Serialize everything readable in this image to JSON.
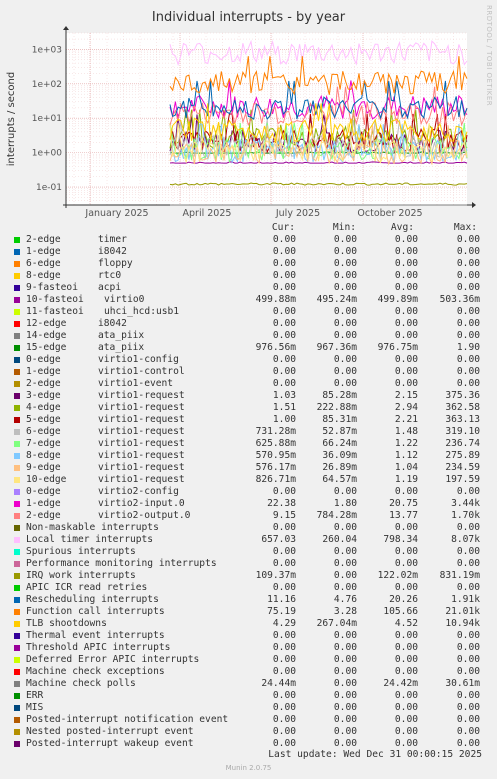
{
  "chart_data": {
    "type": "line",
    "title": "Individual interrupts - by year",
    "ylabel": "interrupts / second",
    "yscale": "log",
    "ylim": [
      0.03,
      3000
    ],
    "yticks": [
      "1e+03",
      "1e+02",
      "1e+01",
      "1e+00",
      "1e-01"
    ],
    "xticks": [
      "January 2025",
      "April 2025",
      "July 2025",
      "October 2025"
    ],
    "grid": true,
    "columns": [
      "Cur:",
      "Min:",
      "Avg:",
      "Max:"
    ],
    "series": [
      {
        "name": "2-edge",
        "device": "timer",
        "color": "#00cc00",
        "cur": "0.00",
        "min": "0.00",
        "avg": "0.00",
        "max": "0.00"
      },
      {
        "name": "1-edge",
        "device": "i8042",
        "color": "#0066b3",
        "cur": "0.00",
        "min": "0.00",
        "avg": "0.00",
        "max": "0.00"
      },
      {
        "name": "6-edge",
        "device": "floppy",
        "color": "#ff8000",
        "cur": "0.00",
        "min": "0.00",
        "avg": "0.00",
        "max": "0.00"
      },
      {
        "name": "8-edge",
        "device": "rtc0",
        "color": "#ffcc00",
        "cur": "0.00",
        "min": "0.00",
        "avg": "0.00",
        "max": "0.00"
      },
      {
        "name": "9-fasteoi",
        "device": "acpi",
        "color": "#330099",
        "cur": "0.00",
        "min": "0.00",
        "avg": "0.00",
        "max": "0.00"
      },
      {
        "name": "10-fasteoi",
        "device": "virtio0",
        "color": "#990099",
        "cur": "499.88m",
        "min": "495.24m",
        "avg": "499.89m",
        "max": "503.36m"
      },
      {
        "name": "11-fasteoi",
        "device": "uhci_hcd:usb1",
        "color": "#ccff00",
        "cur": "0.00",
        "min": "0.00",
        "avg": "0.00",
        "max": "0.00"
      },
      {
        "name": "12-edge",
        "device": "i8042",
        "color": "#ff0000",
        "cur": "0.00",
        "min": "0.00",
        "avg": "0.00",
        "max": "0.00"
      },
      {
        "name": "14-edge",
        "device": "ata_piix",
        "color": "#808080",
        "cur": "0.00",
        "min": "0.00",
        "avg": "0.00",
        "max": "0.00"
      },
      {
        "name": "15-edge",
        "device": "ata_piix",
        "color": "#008f00",
        "cur": "976.56m",
        "min": "967.36m",
        "avg": "976.75m",
        "max": "1.90"
      },
      {
        "name": "0-edge",
        "device": "virtio1-config",
        "color": "#00487d",
        "cur": "0.00",
        "min": "0.00",
        "avg": "0.00",
        "max": "0.00"
      },
      {
        "name": "1-edge",
        "device": "virtio1-control",
        "color": "#b35a00",
        "cur": "0.00",
        "min": "0.00",
        "avg": "0.00",
        "max": "0.00"
      },
      {
        "name": "2-edge",
        "device": "virtio1-event",
        "color": "#b38f00",
        "cur": "0.00",
        "min": "0.00",
        "avg": "0.00",
        "max": "0.00"
      },
      {
        "name": "3-edge",
        "device": "virtio1-request",
        "color": "#6b006b",
        "cur": "1.03",
        "min": "85.28m",
        "avg": "2.15",
        "max": "375.36"
      },
      {
        "name": "4-edge",
        "device": "virtio1-request",
        "color": "#8fb300",
        "cur": "1.51",
        "min": "222.88m",
        "avg": "2.94",
        "max": "362.58"
      },
      {
        "name": "5-edge",
        "device": "virtio1-request",
        "color": "#b30000",
        "cur": "1.00",
        "min": "85.31m",
        "avg": "2.21",
        "max": "363.13"
      },
      {
        "name": "6-edge",
        "device": "virtio1-request",
        "color": "#bebebe",
        "cur": "731.28m",
        "min": "52.87m",
        "avg": "1.48",
        "max": "319.10"
      },
      {
        "name": "7-edge",
        "device": "virtio1-request",
        "color": "#80ff80",
        "cur": "625.88m",
        "min": "66.24m",
        "avg": "1.22",
        "max": "236.74"
      },
      {
        "name": "8-edge",
        "device": "virtio1-request",
        "color": "#80c9ff",
        "cur": "570.95m",
        "min": "36.09m",
        "avg": "1.12",
        "max": "275.89"
      },
      {
        "name": "9-edge",
        "device": "virtio1-request",
        "color": "#ffc080",
        "cur": "576.17m",
        "min": "26.89m",
        "avg": "1.04",
        "max": "234.59"
      },
      {
        "name": "10-edge",
        "device": "virtio1-request",
        "color": "#ffe680",
        "cur": "826.71m",
        "min": "64.57m",
        "avg": "1.19",
        "max": "197.59"
      },
      {
        "name": "0-edge",
        "device": "virtio2-config",
        "color": "#aa80ff",
        "cur": "0.00",
        "min": "0.00",
        "avg": "0.00",
        "max": "0.00"
      },
      {
        "name": "1-edge",
        "device": "virtio2-input.0",
        "color": "#ee00cc",
        "cur": "22.38",
        "min": "1.80",
        "avg": "20.75",
        "max": "3.44k"
      },
      {
        "name": "2-edge",
        "device": "virtio2-output.0",
        "color": "#ff8080",
        "cur": "9.15",
        "min": "784.28m",
        "avg": "13.77",
        "max": "1.70k"
      },
      {
        "name": "Non-maskable interrupts",
        "device": "",
        "color": "#666600",
        "cur": "0.00",
        "min": "0.00",
        "avg": "0.00",
        "max": "0.00"
      },
      {
        "name": "Local timer interrupts",
        "device": "",
        "color": "#ffbfff",
        "cur": "657.03",
        "min": "260.04",
        "avg": "798.34",
        "max": "8.07k"
      },
      {
        "name": "Spurious interrupts",
        "device": "",
        "color": "#00ffcc",
        "cur": "0.00",
        "min": "0.00",
        "avg": "0.00",
        "max": "0.00"
      },
      {
        "name": "Performance monitoring interrupts",
        "device": "",
        "color": "#cc6699",
        "cur": "0.00",
        "min": "0.00",
        "avg": "0.00",
        "max": "0.00"
      },
      {
        "name": "IRQ work interrupts",
        "device": "",
        "color": "#999900",
        "cur": "109.37m",
        "min": "0.00",
        "avg": "122.02m",
        "max": "831.19m"
      },
      {
        "name": "APIC ICR read retries",
        "device": "",
        "color": "#00cc00",
        "cur": "0.00",
        "min": "0.00",
        "avg": "0.00",
        "max": "0.00"
      },
      {
        "name": "Rescheduling interrupts",
        "device": "",
        "color": "#0066b3",
        "cur": "11.16",
        "min": "4.76",
        "avg": "20.26",
        "max": "1.91k"
      },
      {
        "name": "Function call interrupts",
        "device": "",
        "color": "#ff8000",
        "cur": "75.19",
        "min": "3.28",
        "avg": "105.66",
        "max": "21.01k"
      },
      {
        "name": "TLB shootdowns",
        "device": "",
        "color": "#ffcc00",
        "cur": "4.29",
        "min": "267.04m",
        "avg": "4.52",
        "max": "10.94k"
      },
      {
        "name": "Thermal event interrupts",
        "device": "",
        "color": "#330099",
        "cur": "0.00",
        "min": "0.00",
        "avg": "0.00",
        "max": "0.00"
      },
      {
        "name": "Threshold APIC interrupts",
        "device": "",
        "color": "#990099",
        "cur": "0.00",
        "min": "0.00",
        "avg": "0.00",
        "max": "0.00"
      },
      {
        "name": "Deferred Error APIC interrupts",
        "device": "",
        "color": "#ccff00",
        "cur": "0.00",
        "min": "0.00",
        "avg": "0.00",
        "max": "0.00"
      },
      {
        "name": "Machine check exceptions",
        "device": "",
        "color": "#ff0000",
        "cur": "0.00",
        "min": "0.00",
        "avg": "0.00",
        "max": "0.00"
      },
      {
        "name": "Machine check polls",
        "device": "",
        "color": "#808080",
        "cur": "24.44m",
        "min": "0.00",
        "avg": "24.42m",
        "max": "30.61m"
      },
      {
        "name": "ERR",
        "device": "",
        "color": "#008f00",
        "cur": "0.00",
        "min": "0.00",
        "avg": "0.00",
        "max": "0.00"
      },
      {
        "name": "MIS",
        "device": "",
        "color": "#00487d",
        "cur": "0.00",
        "min": "0.00",
        "avg": "0.00",
        "max": "0.00"
      },
      {
        "name": "Posted-interrupt notification event",
        "device": "",
        "color": "#b35a00",
        "cur": "0.00",
        "min": "0.00",
        "avg": "0.00",
        "max": "0.00"
      },
      {
        "name": "Nested posted-interrupt event",
        "device": "",
        "color": "#b38f00",
        "cur": "0.00",
        "min": "0.00",
        "avg": "0.00",
        "max": "0.00"
      },
      {
        "name": "Posted-interrupt wakeup event",
        "device": "",
        "color": "#6b006b",
        "cur": "0.00",
        "min": "0.00",
        "avg": "0.00",
        "max": "0.00"
      }
    ]
  },
  "watermark": "RRDTOOL / TOBI OETIKER",
  "footer": "Last update: Wed Dec 31 00:00:15 2025",
  "generator": "Munin 2.0.75"
}
